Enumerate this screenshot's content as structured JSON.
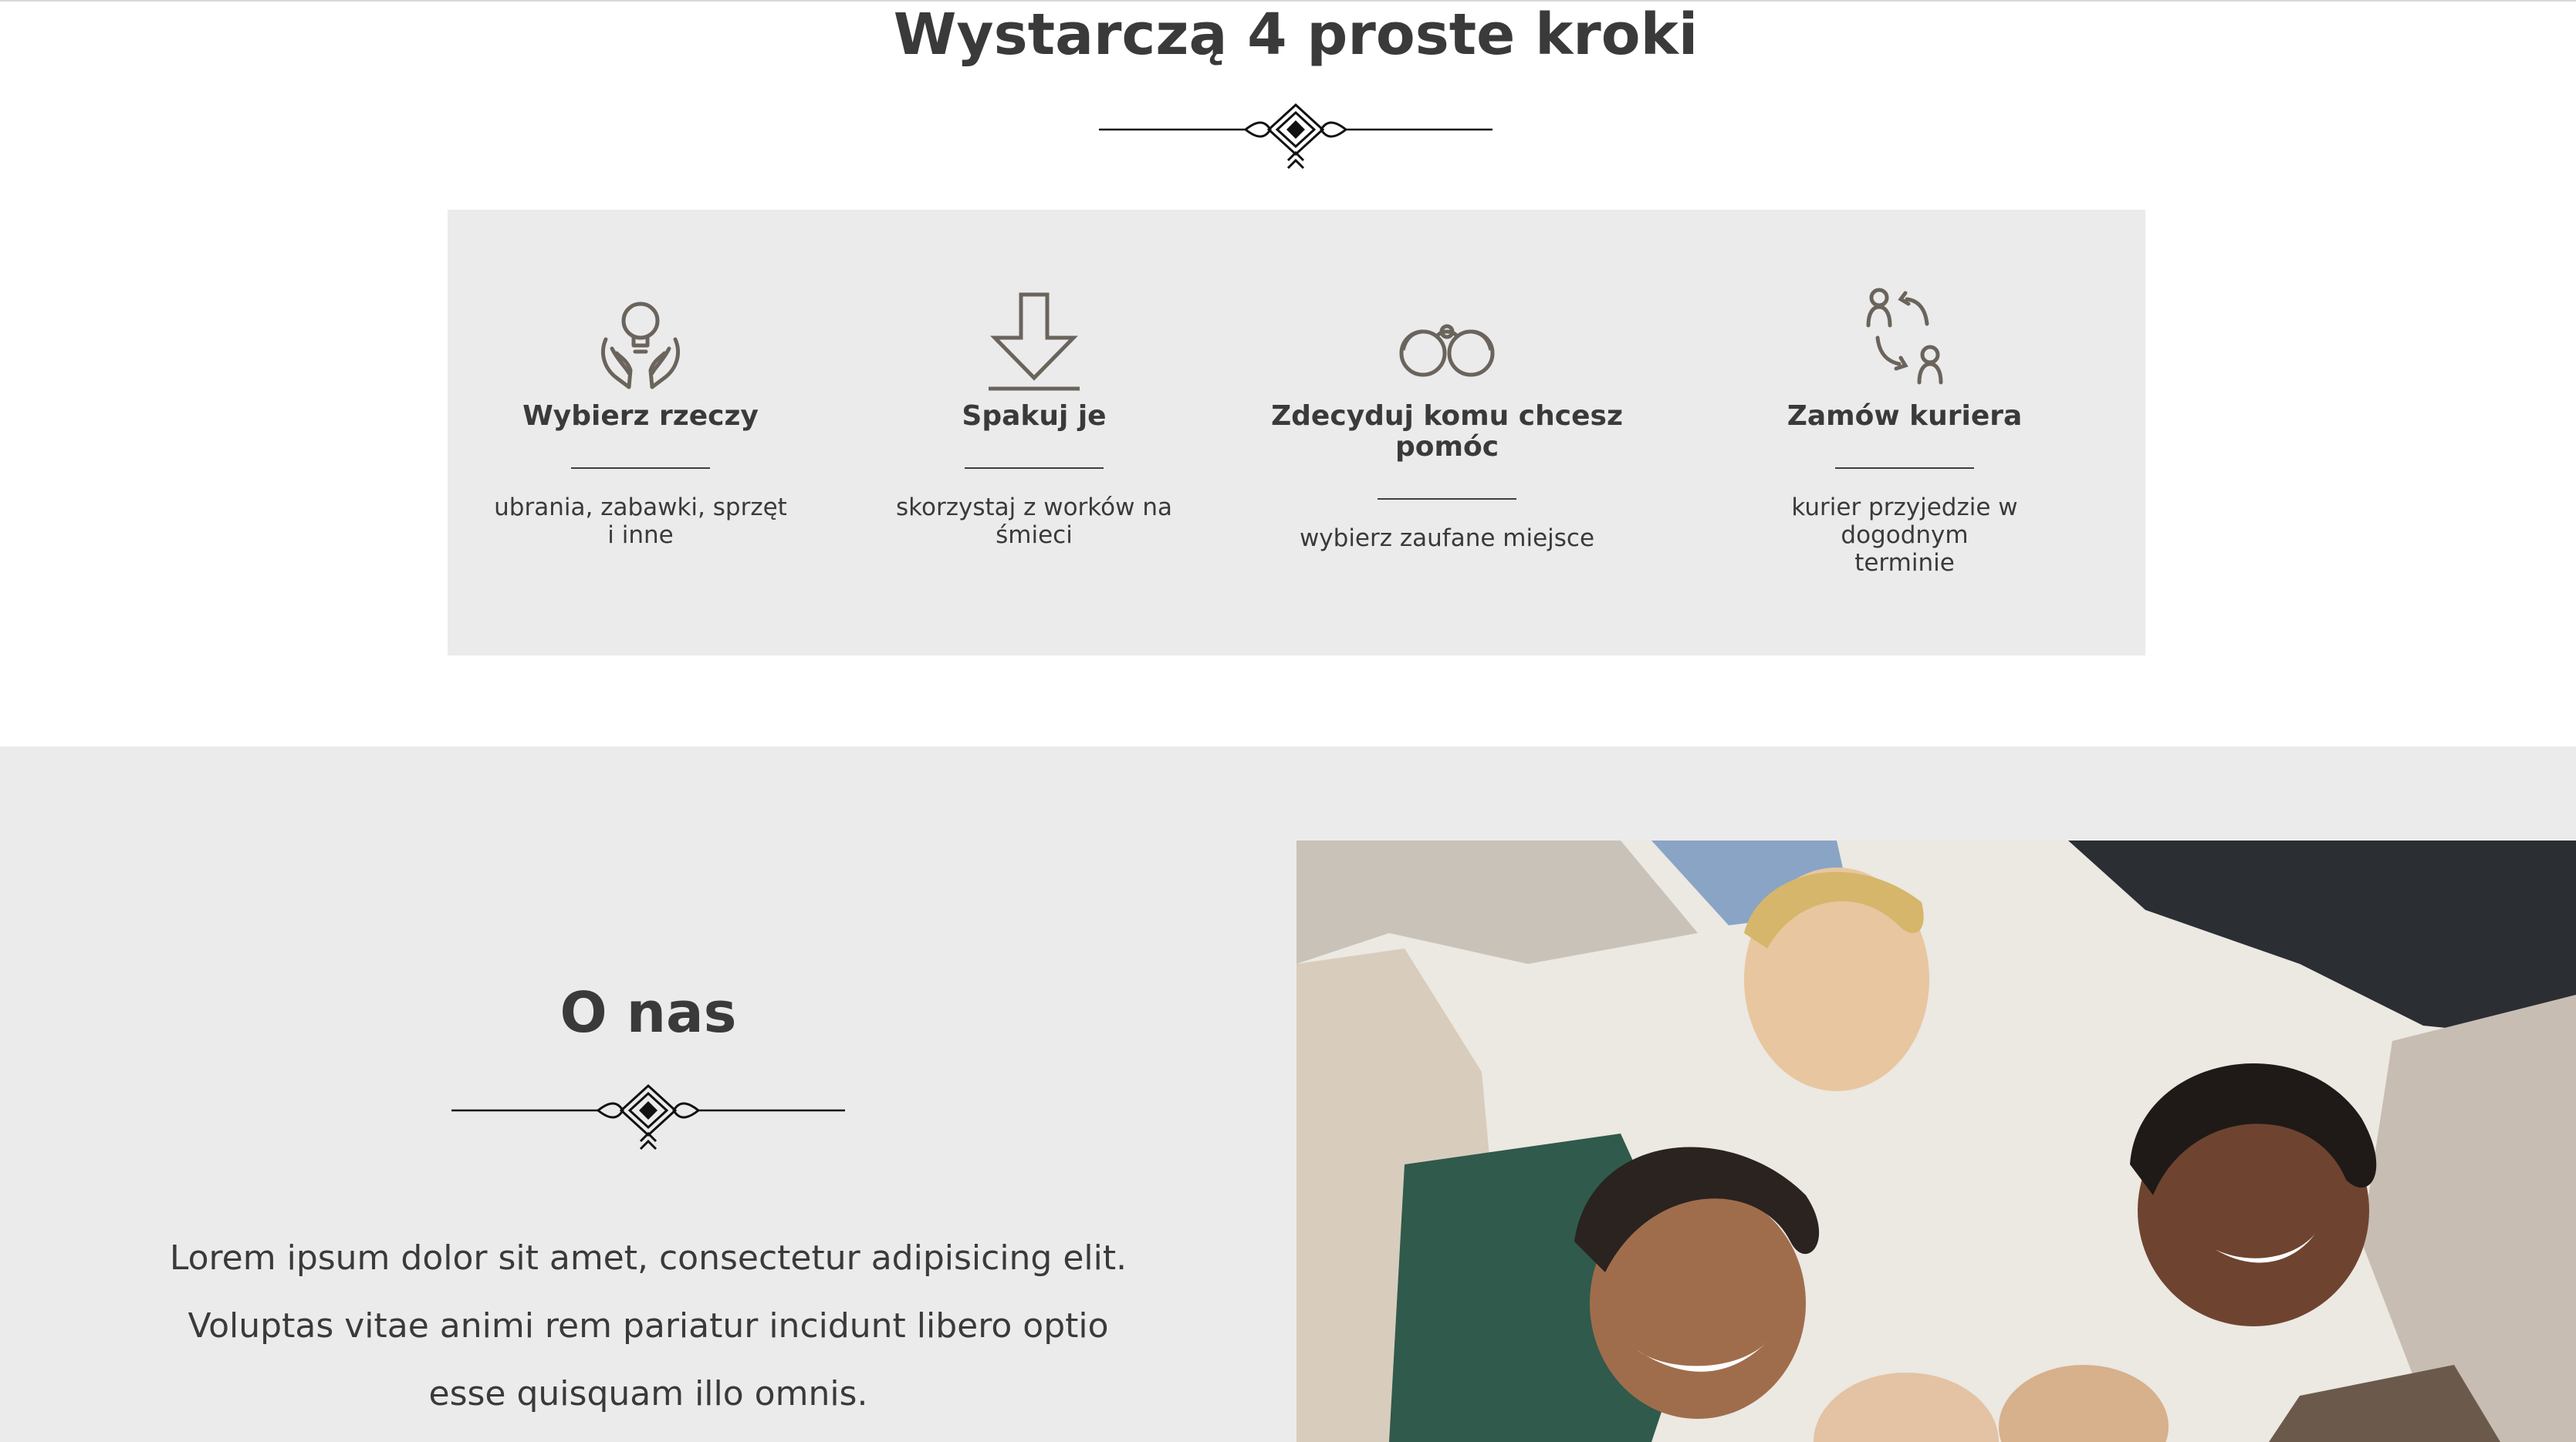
{
  "steps_section": {
    "title": "Wystarczą 4 proste kroki",
    "steps": [
      {
        "icon": "hands-lightbulb-icon",
        "title": "Wybierz rzeczy",
        "desc_lines": [
          "ubrania, zabawki, sprzęt",
          "i inne"
        ]
      },
      {
        "icon": "download-arrow-icon",
        "title": "Spakuj je",
        "desc_lines": [
          "skorzystaj z worków na",
          "śmieci"
        ]
      },
      {
        "icon": "binoculars-icon",
        "title_lines": [
          "Zdecyduj komu chcesz",
          "pomóc"
        ],
        "desc_lines": [
          "wybierz zaufane miejsce"
        ]
      },
      {
        "icon": "people-exchange-icon",
        "title": "Zamów kuriera",
        "desc_lines": [
          "kurier przyjedzie w dogodnym",
          "terminie"
        ]
      }
    ]
  },
  "about_section": {
    "title": "O nas",
    "text_lines": [
      "Lorem ipsum dolor sit amet, consectetur adipisicing elit.",
      "Voluptas vitae animi rem pariatur incidunt libero optio",
      "esse quisquam illo omnis."
    ],
    "photo": "group-of-people-photo"
  },
  "colors": {
    "panel_bg": "#ebebeb",
    "text": "#3a3a3a",
    "icon": "#6b645c"
  }
}
